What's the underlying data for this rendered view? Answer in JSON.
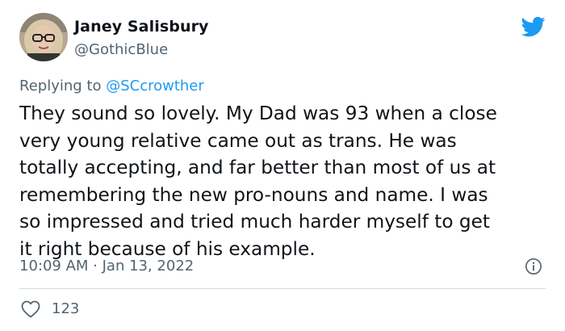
{
  "author": {
    "display_name": "Janey Salisbury",
    "handle": "@GothicBlue"
  },
  "reply": {
    "prefix": "Replying to ",
    "to_handle": "@SCcrowther"
  },
  "tweet": {
    "text": "They sound so lovely. My Dad was 93 when a close\nvery young relative came out as trans. He was\ntotally accepting, and far better than most of us at\nremembering the new pro-nouns and name. I was\nso impressed and tried much harder myself to get\nit right because of his example.",
    "timestamp": "10:09 AM · Jan 13, 2022"
  },
  "engagement": {
    "likes": "123"
  },
  "icons": {
    "brand": "twitter-bird-icon",
    "info": "info-icon",
    "like": "heart-icon"
  },
  "colors": {
    "twitter_blue": "#1d9bf0",
    "secondary_text": "#536471",
    "divider": "#cfd9de"
  }
}
